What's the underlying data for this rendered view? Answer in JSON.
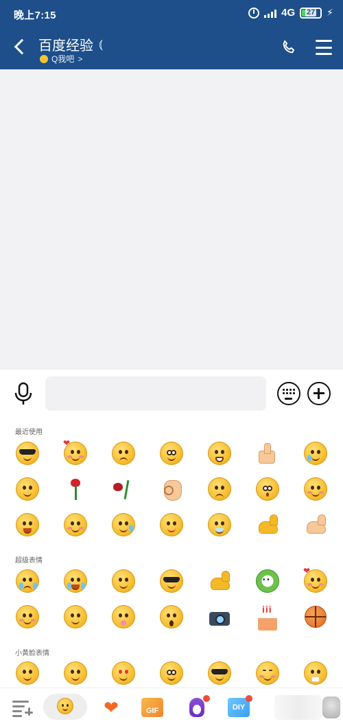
{
  "status_bar": {
    "time": "晚上7:15",
    "network": "4G",
    "battery": "27"
  },
  "header": {
    "title": "百度经验",
    "subtitle": "Q我吧",
    "subtitle_chevron": ">",
    "icons": [
      "back-icon",
      "ear-icon",
      "phone-icon",
      "menu-icon"
    ],
    "background_color": "#1e4f8a"
  },
  "input_bar": {
    "placeholder": "",
    "icons": [
      "microphone-icon",
      "keyboard-icon",
      "plus-icon"
    ]
  },
  "emoji_panel": {
    "sections": [
      {
        "label": "最近使用",
        "rows": [
          [
            "sunglasses-face",
            "heart-eyes-face",
            "angry-face",
            "scared-face",
            "grinning-face",
            "thumbs-up",
            "laugh-cry-face"
          ],
          [
            "tongue-face",
            "rose",
            "wilted-rose",
            "ok-hand",
            "sad-face",
            "surprised-face",
            "smug-face"
          ],
          [
            "laughing-face",
            "hand-face",
            "thinking-sweat-face",
            "spitting-face",
            "drooling-face",
            "muscle",
            "muscle-light"
          ]
        ]
      },
      {
        "label": "超级表情",
        "rows": [
          [
            "crying-face",
            "laugh-cry-face",
            "smiling-face",
            "sunglasses-face",
            "muscle",
            "cabbage-dog",
            "heart-eyes-face"
          ],
          [
            "shy-face",
            "party-face",
            "lollipop-face",
            "screaming-face",
            "camera",
            "birthday-cake",
            "basketball"
          ]
        ]
      },
      {
        "label": "小黄脸表情",
        "rows": [
          [
            "smile-face",
            "sweat-face",
            "heart-eyes-face",
            "tearful-face",
            "cool-face",
            "shy-face",
            "wrapped-face"
          ]
        ]
      }
    ]
  },
  "tab_bar": {
    "items": [
      "emoji-list-icon",
      "smiley-icon",
      "heart-icon",
      "gif-icon",
      "penguin-icon",
      "diy-icon"
    ],
    "gif_label": "GIF",
    "diy_label": "DIY",
    "heart_glyph": "❤"
  }
}
